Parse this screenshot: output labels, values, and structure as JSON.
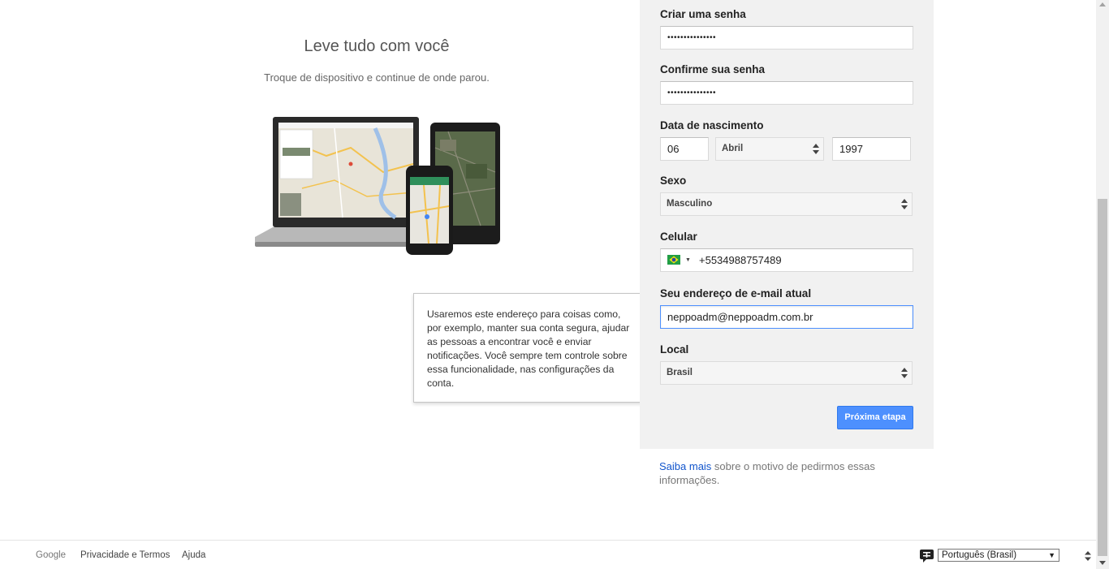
{
  "promo": {
    "title": "Leve tudo com você",
    "subtitle": "Troque de dispositivo e continue de onde parou."
  },
  "tooltip": {
    "text": "Usaremos este endereço para coisas como, por exemplo, manter sua conta segura, ajudar as pessoas a encontrar você e enviar notificações. Você sempre tem controle sobre essa funcionalidade, nas configurações da conta."
  },
  "form": {
    "password_label": "Criar uma senha",
    "password_value": "•••••••••••••••",
    "confirm_label": "Confirme sua senha",
    "confirm_value": "•••••••••••••••",
    "birthdate_label": "Data de nascimento",
    "birth_day": "06",
    "birth_month": "Abril",
    "birth_year": "1997",
    "gender_label": "Sexo",
    "gender_value": "Masculino",
    "phone_label": "Celular",
    "phone_value": "+5534988757489",
    "email_label": "Seu endereço de e-mail atual",
    "email_value": "neppoadm@neppoadm.com.br",
    "location_label": "Local",
    "location_value": "Brasil",
    "next_button": "Próxima etapa"
  },
  "learn_more": {
    "link": "Saiba mais",
    "text": " sobre o motivo de pedirmos essas informações."
  },
  "footer": {
    "google": "Google",
    "privacy": "Privacidade e Termos",
    "help": "Ajuda",
    "language": "Português (Brasil)"
  },
  "colors": {
    "accent": "#4d90fe",
    "link": "#1155cc",
    "panel": "#f1f1f1"
  }
}
